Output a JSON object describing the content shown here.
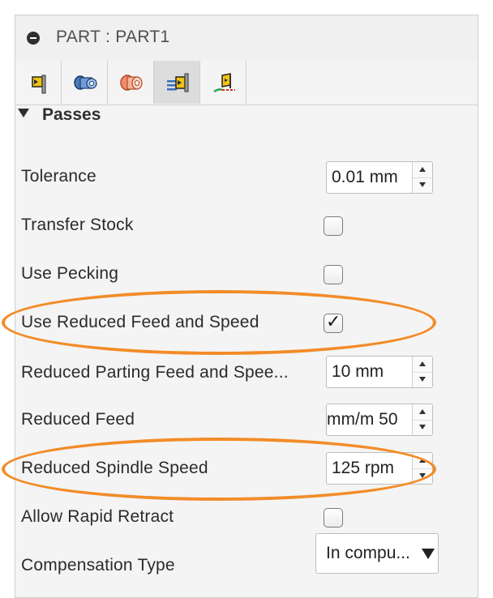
{
  "panel": {
    "title": "PART : PART1",
    "tabs": [
      {
        "icon": "tool-icon",
        "active": false
      },
      {
        "icon": "geometry-icon",
        "active": false
      },
      {
        "icon": "stock-icon",
        "active": false
      },
      {
        "icon": "passes-icon",
        "active": true
      },
      {
        "icon": "linking-icon",
        "active": false
      }
    ]
  },
  "section": {
    "title": "Passes"
  },
  "rows": {
    "tolerance": {
      "label": "Tolerance",
      "value": "0.01 mm"
    },
    "transfer_stock": {
      "label": "Transfer Stock",
      "checked": false
    },
    "use_pecking": {
      "label": "Use Pecking",
      "checked": false
    },
    "use_reduced": {
      "label": "Use Reduced Feed and Speed",
      "checked": true,
      "check_glyph": "✓"
    },
    "reduced_parting": {
      "label": "Reduced Parting Feed and Spee...",
      "value": "10 mm"
    },
    "reduced_feed": {
      "label": "Reduced Feed",
      "value": "50 mm/m"
    },
    "reduced_spindle": {
      "label": "Reduced Spindle Speed",
      "value": "125 rpm"
    },
    "allow_rapid": {
      "label": "Allow Rapid Retract",
      "checked": false
    },
    "compensation": {
      "label": "Compensation Type",
      "value": "In compu..."
    }
  },
  "colors": {
    "highlight": "#f28c28",
    "tab_active": "#dcdcdc"
  }
}
